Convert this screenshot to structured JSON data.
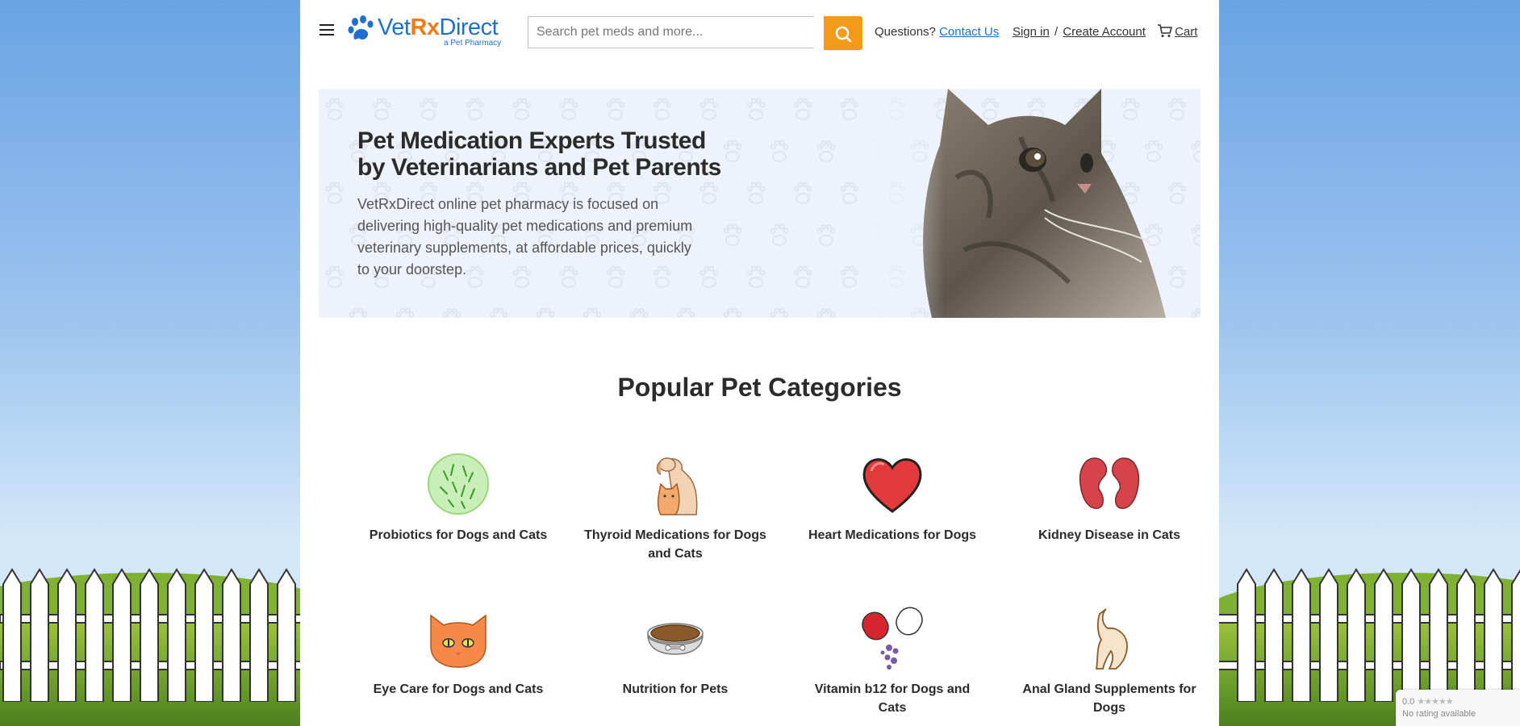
{
  "header": {
    "menu_icon": "hamburger-menu-icon",
    "logo": {
      "brand_pre": "Vet",
      "brand_rx": "Rx",
      "brand_post": "Direct",
      "tagline": "a Pet Pharmacy",
      "brand_color": "#1f6fd1",
      "rx_color": "#ef7a1a"
    },
    "search": {
      "placeholder": "Search pet meds and more...",
      "value": "",
      "button_icon": "search-icon",
      "button_color": "#f39a1c"
    },
    "questions_label": "Questions?",
    "contact_link": "Contact Us",
    "signin_link": "Sign in",
    "separator": "/",
    "create_account_link": "Create Account",
    "cart_label": "Cart",
    "cart_icon": "cart-icon"
  },
  "hero": {
    "title": "Pet Medication Experts Trusted by Veterinarians and Pet Parents",
    "description": "VetRxDirect online pet pharmacy is focused on delivering high-quality pet medications and premium veterinary supplements, at affordable prices, quickly to your doorstep.",
    "image": "tabby-cat-photo"
  },
  "categories": {
    "title": "Popular Pet Categories",
    "items": [
      {
        "label": "Probiotics for Dogs and Cats",
        "icon": "probiotics-icon"
      },
      {
        "label": "Thyroid Medications for Dogs and Cats",
        "icon": "dog-cat-icon"
      },
      {
        "label": "Heart Medications for Dogs",
        "icon": "heart-icon"
      },
      {
        "label": "Kidney Disease in Cats",
        "icon": "kidneys-icon"
      },
      {
        "label": "Eye Care for Dogs and Cats",
        "icon": "cat-face-icon"
      },
      {
        "label": "Nutrition for Pets",
        "icon": "food-bowl-icon"
      },
      {
        "label": "Vitamin b12 for Dogs and Cats",
        "icon": "capsule-icon"
      },
      {
        "label": "Anal Gland Supplements for Dogs",
        "icon": "dog-rear-icon"
      }
    ]
  },
  "rating_badge": {
    "score": "0.0",
    "stars": "★★★★★",
    "text": "No rating available"
  }
}
